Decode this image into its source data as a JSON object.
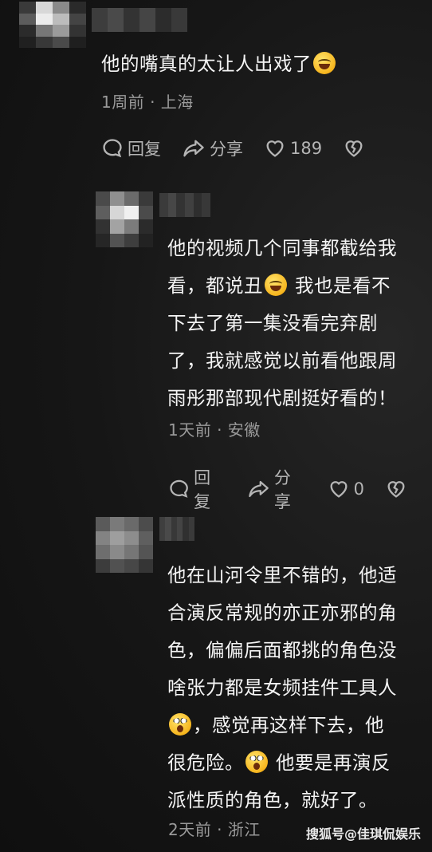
{
  "comments": [
    {
      "text_lines": [
        "他的嘴真的太让人出戏了"
      ],
      "meta": "1周前 · 上海",
      "reply_label": "回复",
      "share_label": "分享",
      "like_count": "189"
    },
    {
      "text_lines": [
        "他的视频几个同事都截给我",
        "看，都说丑",
        "我也是看不",
        "下去了第一集没看完弃剧",
        "了，我就感觉以前看他跟周",
        "雨彤那部现代剧挺好看的！"
      ],
      "meta": "1天前 · 安徽",
      "reply_label": "回复",
      "share_label": "分享",
      "like_count": "0"
    },
    {
      "text_lines": [
        "他在山河令里不错的，他适",
        "合演反常规的亦正亦邪的角",
        "色，偏偏后面都挑的角色没",
        "啥张力都是女频挂件工具人",
        "，感觉再这样下去，他",
        "很危险。",
        "他要是再演反",
        "派性质的角色，就好了。"
      ],
      "meta": "2天前 · 浙江"
    }
  ],
  "watermark": "搜狐号@佳琪侃娱乐",
  "icons": [
    "comment-bubble-icon",
    "share-arrow-icon",
    "heart-icon",
    "broken-heart-icon",
    "laughing-emoji-icon",
    "shocked-emoji-icon"
  ]
}
